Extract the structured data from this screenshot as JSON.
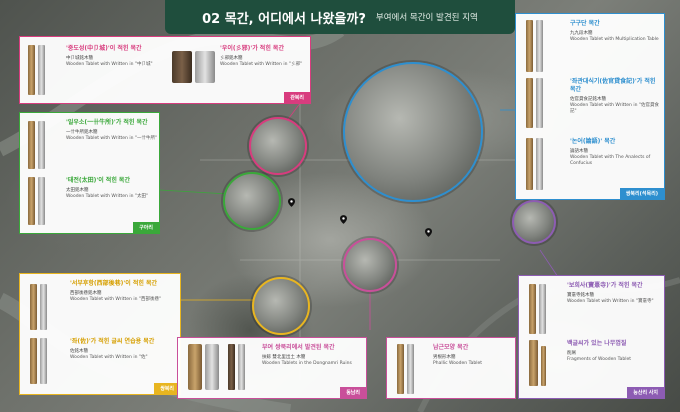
{
  "header": {
    "title": "02 목간, 어디에서 나왔을까?",
    "subtitle": "부여에서 목간이 발견된 지역"
  },
  "colors": {
    "banner": "#1f4e3d",
    "gwanbukri": "#d83c7e",
    "gugari": "#3aa83a",
    "ssangbukri": "#e8b520",
    "dongnamri": "#c94f9a",
    "ssangbuk_jeonghyeonri": "#2e8fcf",
    "neungsanri": "#8d5cb3"
  },
  "panels": {
    "gwanbukri": {
      "tag": "관북리",
      "items": [
        {
          "title": "'중도성(中卩城)'이 적힌 목간",
          "hanja": "中卩城銘木簡",
          "en": "Wooden Tablet with Written in \"中卩城\""
        },
        {
          "title": "'우이(彡邪)'가 적힌 목간",
          "hanja": "彡邪銘木簡",
          "en": "Wooden Tablet with Written in \"彡邪\""
        }
      ]
    },
    "gugari": {
      "tag": "구아리",
      "items": [
        {
          "title": "'일우소(一卄牛所)'가 적힌 목간",
          "hanja": "一卄牛所銘木簡",
          "en": "Wooden Tablet with Written in \"一卄牛所\""
        },
        {
          "title": "'태전(太田)'이 적힌 목간",
          "hanja": "太田銘木簡",
          "en": "Wooden Tablet with Written in \"太田\""
        }
      ]
    },
    "ssangbukri": {
      "tag": "쌍북리",
      "items": [
        {
          "title": "'서부후항(西部後巷)'이 적힌 목간",
          "hanja": "西部後巷銘木簡",
          "en": "Wooden Tablet with Written in \"西部後巷\""
        },
        {
          "title": "'좌(佐)'가 적힌 글씨 연습용 목간",
          "hanja": "佐銘木簡",
          "en": "Wooden Tablet with Written in \"佐\""
        }
      ]
    },
    "dongnamri": {
      "tag": "동남리",
      "items": [
        {
          "title": "부여 쌍북리에서 발견된 목간",
          "hanja": "扶餘 雙北里出土 木簡",
          "en": "Wooden Tablets in the Dongnamri Ruins"
        },
        {
          "title": "남근모양 목간",
          "hanja": "男根形木簡",
          "en": "Phallic Wooden Tablet"
        }
      ]
    },
    "ssangbuk_jeonghyeonri": {
      "tag": "쌍북리(석목리)",
      "items": [
        {
          "title": "구구단 목간",
          "hanja": "九九段木簡",
          "en": "Wooden Tablet with Multiplication Table"
        },
        {
          "title": "'좌관대식기(佐官貸食記)'가 적힌 목간",
          "hanja": "佐官貸食記銘木簡",
          "en": "Wooden Tablet with Written in \"佐官貸食記\""
        },
        {
          "title": "'논어(論語)' 목간",
          "hanja": "論語木簡",
          "en": "Wooden Tablet with The Analects of Confucius"
        }
      ]
    },
    "neungsanri": {
      "tag": "능산리 사지",
      "items": [
        {
          "title": "'보희사(寶憙寺)'가 적힌 목간",
          "hanja": "寶憙寺銘木簡",
          "en": "Wooden Tablet with Written in \"寶憙寺\""
        },
        {
          "title": "백글씨가 있는 나무껍질",
          "hanja": "削屑",
          "en": "Fragments of Wooden Tablet"
        }
      ]
    }
  }
}
